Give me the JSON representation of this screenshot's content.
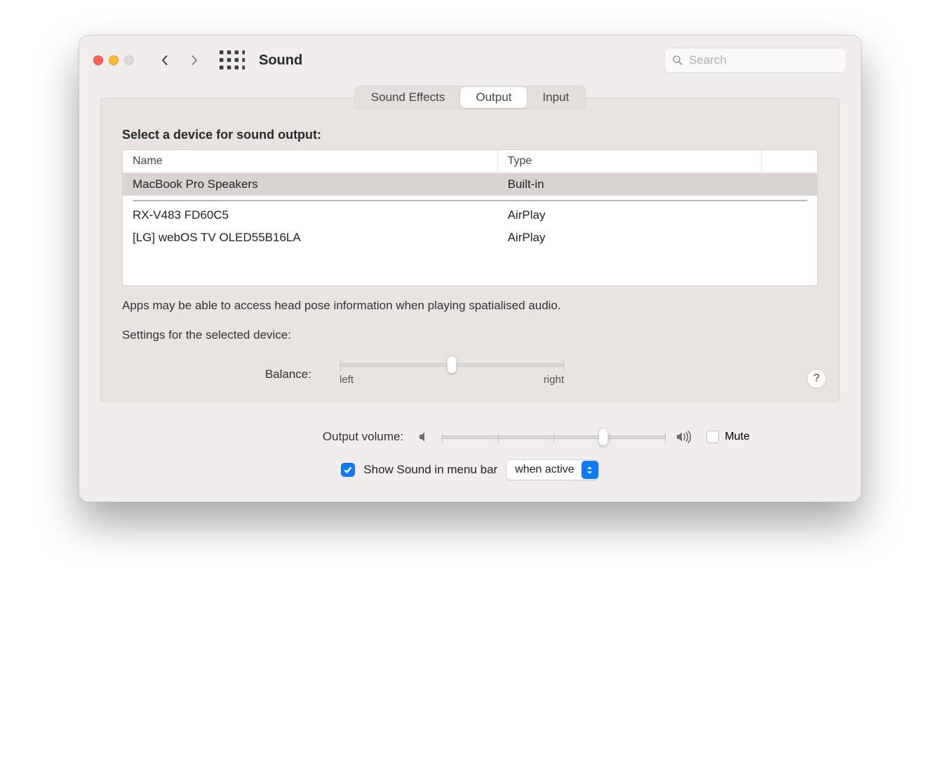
{
  "window": {
    "title": "Sound"
  },
  "toolbar": {
    "search_placeholder": "Search"
  },
  "tabs": {
    "items": [
      {
        "label": "Sound Effects",
        "active": false
      },
      {
        "label": "Output",
        "active": true
      },
      {
        "label": "Input",
        "active": false
      }
    ]
  },
  "section": {
    "title": "Select a device for sound output:",
    "columns": {
      "name": "Name",
      "type": "Type"
    },
    "devices": [
      {
        "name": "MacBook Pro Speakers",
        "type": "Built-in",
        "selected": true
      },
      {
        "name": "RX-V483 FD60C5",
        "type": "AirPlay",
        "selected": false
      },
      {
        "name": "[LG] webOS TV OLED55B16LA",
        "type": "AirPlay",
        "selected": false
      }
    ],
    "info": "Apps may be able to access head pose information when playing spatialised audio.",
    "settings_heading": "Settings for the selected device:"
  },
  "balance": {
    "label": "Balance:",
    "left_label": "left",
    "right_label": "right",
    "value_percent": 50
  },
  "volume": {
    "label": "Output volume:",
    "value_percent": 72,
    "mute_label": "Mute",
    "mute_checked": false
  },
  "menubar": {
    "show_label": "Show Sound in menu bar",
    "show_checked": true,
    "mode_selected": "when active"
  },
  "help_label": "?"
}
